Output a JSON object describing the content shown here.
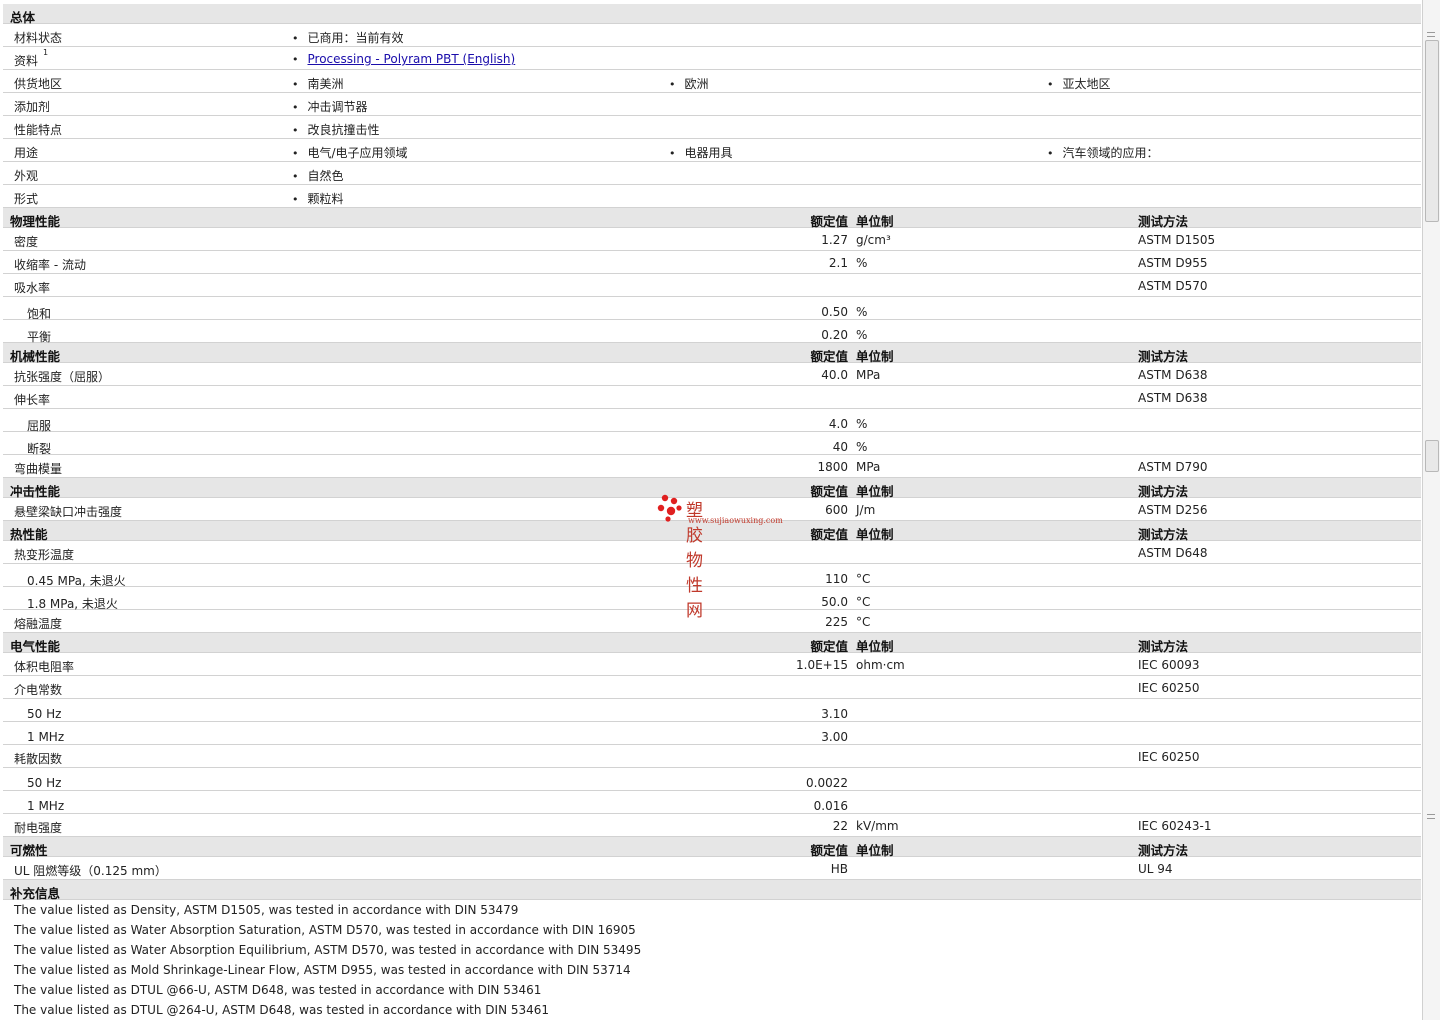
{
  "general": {
    "title": "总体",
    "rows": [
      {
        "label": "材料状态",
        "items": [
          "已商用：当前有效"
        ]
      },
      {
        "label": "资料",
        "sup": "1",
        "link": "Processing - Polyram PBT (English)"
      },
      {
        "label": "供货地区",
        "items": [
          "南美洲",
          "欧洲",
          "亚太地区"
        ]
      },
      {
        "label": "添加剂",
        "items": [
          "冲击调节器"
        ]
      },
      {
        "label": "性能特点",
        "items": [
          "改良抗撞击性"
        ]
      },
      {
        "label": "用途",
        "items": [
          "电气/电子应用领域",
          "电器用具",
          "汽车领域的应用："
        ]
      },
      {
        "label": "外观",
        "items": [
          "自然色"
        ]
      },
      {
        "label": "形式",
        "items": [
          "颗粒料"
        ]
      }
    ]
  },
  "headers": {
    "value": "额定值",
    "unit": "单位制",
    "test": "测试方法"
  },
  "sections": [
    {
      "title": "物理性能",
      "rows": [
        {
          "label": "密度",
          "value": "1.27",
          "unit": "g/cm³",
          "test": "ASTM D1505"
        },
        {
          "label": "收缩率 - 流动",
          "value": "2.1",
          "unit": "%",
          "test": "ASTM D955"
        },
        {
          "label": "吸水率",
          "value": "",
          "unit": "",
          "test": "ASTM D570"
        },
        {
          "label": "饱和",
          "sub": true,
          "value": "0.50",
          "unit": "%",
          "test": ""
        },
        {
          "label": "平衡",
          "sub": true,
          "value": "0.20",
          "unit": "%",
          "test": ""
        }
      ]
    },
    {
      "title": "机械性能",
      "rows": [
        {
          "label": "抗张强度（屈服）",
          "value": "40.0",
          "unit": "MPa",
          "test": "ASTM D638"
        },
        {
          "label": "伸长率",
          "value": "",
          "unit": "",
          "test": "ASTM D638"
        },
        {
          "label": "屈服",
          "sub": true,
          "value": "4.0",
          "unit": "%",
          "test": ""
        },
        {
          "label": "断裂",
          "sub": true,
          "value": "40",
          "unit": "%",
          "test": ""
        },
        {
          "label": "弯曲模量",
          "value": "1800",
          "unit": "MPa",
          "test": "ASTM D790"
        }
      ]
    },
    {
      "title": "冲击性能",
      "rows": [
        {
          "label": "悬壁梁缺口冲击强度",
          "value": "600",
          "unit": "J/m",
          "test": "ASTM D256"
        }
      ]
    },
    {
      "title": "热性能",
      "rows": [
        {
          "label": "热变形温度",
          "value": "",
          "unit": "",
          "test": "ASTM D648"
        },
        {
          "label": "0.45 MPa, 未退火",
          "sub": true,
          "value": "110",
          "unit": "°C",
          "test": ""
        },
        {
          "label": "1.8 MPa, 未退火",
          "sub": true,
          "value": "50.0",
          "unit": "°C",
          "test": ""
        },
        {
          "label": "熔融温度",
          "value": "225",
          "unit": "°C",
          "test": ""
        }
      ]
    },
    {
      "title": "电气性能",
      "rows": [
        {
          "label": "体积电阻率",
          "value": "1.0E+15",
          "unit": "ohm·cm",
          "test": "IEC 60093"
        },
        {
          "label": "介电常数",
          "value": "",
          "unit": "",
          "test": "IEC 60250"
        },
        {
          "label": "50 Hz",
          "sub": true,
          "value": "3.10",
          "unit": "",
          "test": ""
        },
        {
          "label": "1 MHz",
          "sub": true,
          "value": "3.00",
          "unit": "",
          "test": ""
        },
        {
          "label": "耗散因数",
          "value": "",
          "unit": "",
          "test": "IEC 60250"
        },
        {
          "label": "50 Hz",
          "sub": true,
          "value": "0.0022",
          "unit": "",
          "test": ""
        },
        {
          "label": "1 MHz",
          "sub": true,
          "value": "0.016",
          "unit": "",
          "test": ""
        },
        {
          "label": "耐电强度",
          "value": "22",
          "unit": "kV/mm",
          "test": "IEC 60243-1"
        }
      ]
    },
    {
      "title": "可燃性",
      "rows": [
        {
          "label": "UL 阻燃等级（0.125 mm）",
          "value": "HB",
          "unit": "",
          "test": "UL 94"
        }
      ]
    }
  ],
  "notes": {
    "title": "补充信息",
    "lines": [
      "The value listed as Density, ASTM D1505, was tested in accordance with DIN 53479",
      "The value listed as Water Absorption Saturation, ASTM D570, was tested in accordance with DIN 16905",
      "The value listed as Water Absorption Equilibrium, ASTM D570, was tested in accordance with DIN 53495",
      "The value listed as Mold Shrinkage-Linear Flow, ASTM D955, was tested in accordance with DIN 53714",
      "The value listed as DTUL @66-U, ASTM D648, was tested in accordance with DIN 53461",
      "The value listed as DTUL @264-U, ASTM D648, was tested in accordance with DIN 53461"
    ]
  },
  "watermark": {
    "text": "塑胶物性网",
    "url": "www.sujiaowuxing.com",
    "color": "#e02020"
  }
}
